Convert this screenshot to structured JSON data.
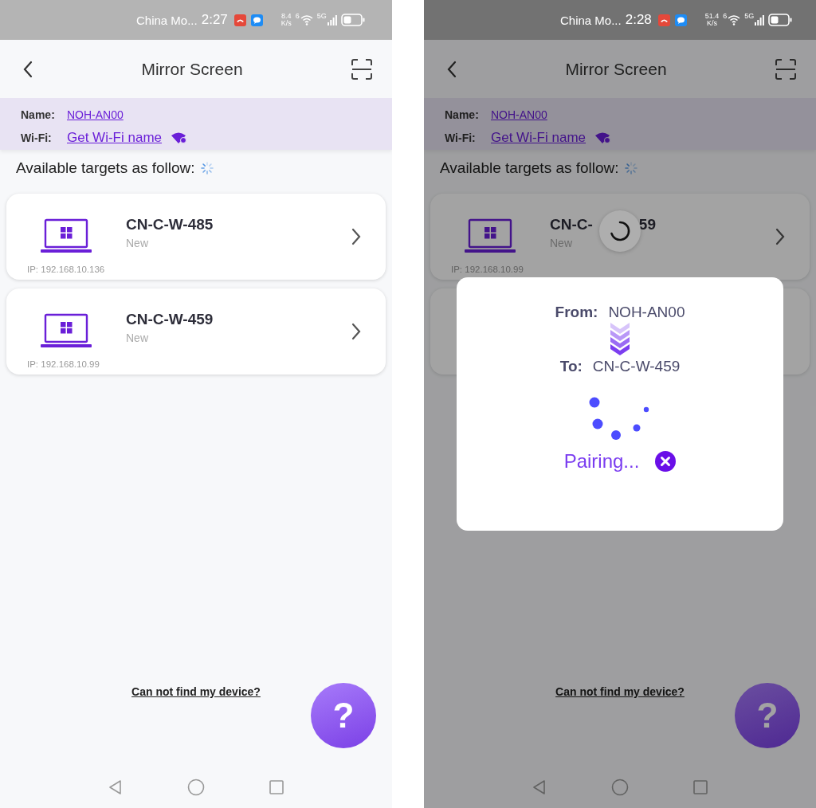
{
  "screens": [
    {
      "status_bar": {
        "carrier": "China Mo...",
        "time": "2:27",
        "speed": "8.4",
        "speed_unit": "K/s",
        "wifi_label": "6",
        "signal_label": "5G"
      },
      "header": {
        "title": "Mirror Screen"
      },
      "info": {
        "name_label": "Name:",
        "name_value": "NOH-AN00",
        "wifi_label": "Wi-Fi:",
        "wifi_value": "Get Wi-Fi name"
      },
      "targets_label": "Available targets as follow:",
      "devices": [
        {
          "kind": "device",
          "name": "CN-C-W-485",
          "status": "New",
          "ip": "IP: 192.168.10.136"
        },
        {
          "kind": "device",
          "name": "CN-C-W-459",
          "status": "New",
          "ip": "IP: 192.168.10.99"
        }
      ],
      "help_link": "Can not find my device?",
      "help_button": "?",
      "dimmed": false
    },
    {
      "status_bar": {
        "carrier": "China Mo...",
        "time": "2:28",
        "speed": "51.4",
        "speed_unit": "K/s",
        "wifi_label": "6",
        "signal_label": "5G"
      },
      "header": {
        "title": "Mirror Screen"
      },
      "info": {
        "name_label": "Name:",
        "name_value": "NOH-AN00",
        "wifi_label": "Wi-Fi:",
        "wifi_value": "Get Wi-Fi name"
      },
      "targets_label": "Available targets as follow:",
      "devices": [
        {
          "kind": "device",
          "name_parts": [
            "CN-C-",
            "59"
          ],
          "status": "New",
          "ip": "IP: 192.168.10.99"
        },
        {
          "kind": "covered"
        }
      ],
      "help_link": "Can not find my device?",
      "help_button": "?",
      "dimmed": true,
      "busy": true,
      "dialog": {
        "from_label": "From:",
        "from_value": "NOH-AN00",
        "to_label": "To:",
        "to_value": "CN-C-W-459",
        "status": "Pairing..."
      }
    }
  ]
}
